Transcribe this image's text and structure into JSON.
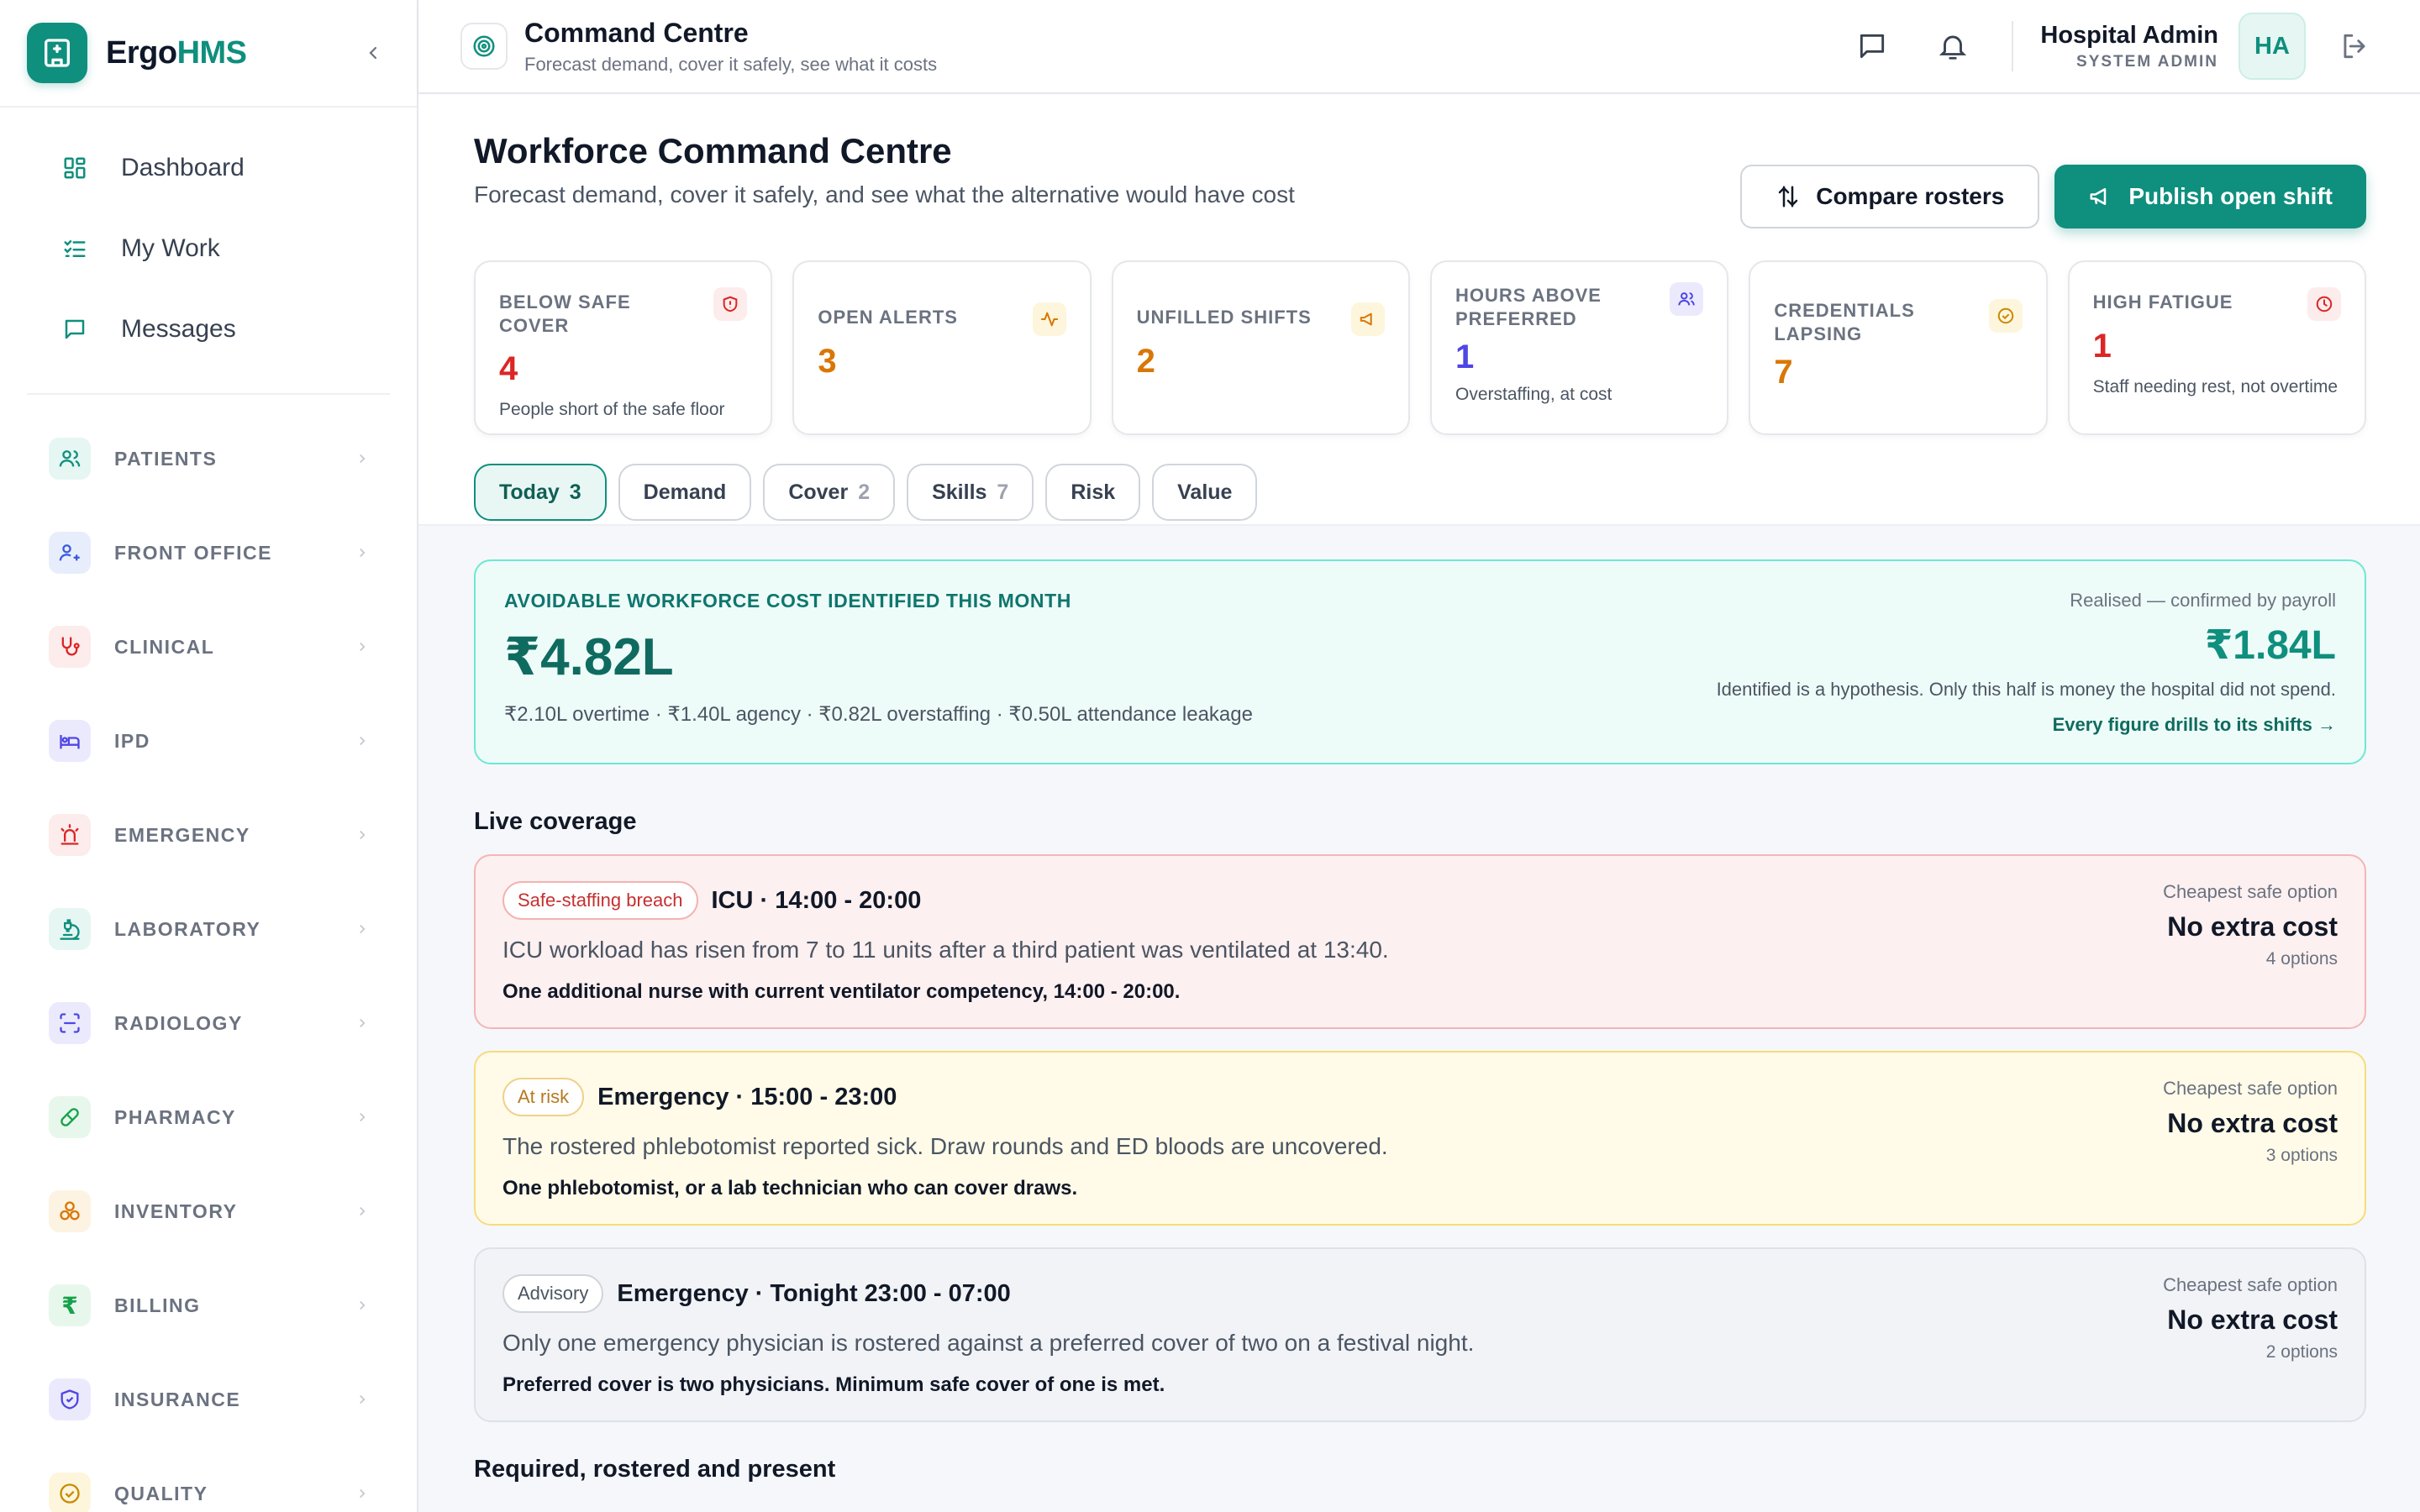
{
  "brand": {
    "name_prefix": "Ergo",
    "name_suffix": "HMS"
  },
  "primary_nav": [
    {
      "label": "Dashboard",
      "icon": "dashboard-icon"
    },
    {
      "label": "My Work",
      "icon": "checklist-icon"
    },
    {
      "label": "Messages",
      "icon": "message-icon"
    }
  ],
  "modules": [
    {
      "label": "PATIENTS",
      "icon": "users-icon",
      "color": "#0f8f7e",
      "bg": "#e6f6f3"
    },
    {
      "label": "FRONT OFFICE",
      "icon": "user-plus-icon",
      "color": "#3b5bdb",
      "bg": "#e8edfc"
    },
    {
      "label": "CLINICAL",
      "icon": "stethoscope-icon",
      "color": "#dc2626",
      "bg": "#fdecec"
    },
    {
      "label": "IPD",
      "icon": "bed-icon",
      "color": "#4f46e5",
      "bg": "#ebeafd"
    },
    {
      "label": "EMERGENCY",
      "icon": "siren-icon",
      "color": "#dc2626",
      "bg": "#fdecec"
    },
    {
      "label": "LABORATORY",
      "icon": "microscope-icon",
      "color": "#0f8f7e",
      "bg": "#e6f6f3"
    },
    {
      "label": "RADIOLOGY",
      "icon": "scan-icon",
      "color": "#4f46e5",
      "bg": "#ebeafd"
    },
    {
      "label": "PHARMACY",
      "icon": "pill-icon",
      "color": "#16a34a",
      "bg": "#e8f7ec"
    },
    {
      "label": "INVENTORY",
      "icon": "boxes-icon",
      "color": "#d97706",
      "bg": "#fdf3e3"
    },
    {
      "label": "BILLING",
      "icon": "rupee-icon",
      "color": "#16a34a",
      "bg": "#e8f7ec",
      "glyph": "₹"
    },
    {
      "label": "INSURANCE",
      "icon": "shield-icon",
      "color": "#4f46e5",
      "bg": "#ebeafd"
    },
    {
      "label": "QUALITY",
      "icon": "badge-check-icon",
      "color": "#ca8a04",
      "bg": "#fdf6dc"
    }
  ],
  "topbar": {
    "title": "Command Centre",
    "subtitle": "Forecast demand, cover it safely, see what it costs",
    "user_name": "Hospital Admin",
    "user_role": "SYSTEM ADMIN",
    "avatar": "HA"
  },
  "page": {
    "title": "Workforce Command Centre",
    "subtitle": "Forecast demand, cover it safely, and see what the alternative would have cost",
    "compare_label": "Compare rosters",
    "publish_label": "Publish open shift"
  },
  "kpis": [
    {
      "label": "BELOW SAFE COVER",
      "value": "4",
      "desc": "People short of the safe floor",
      "color": "#dc2626",
      "icon": "shield-alert-icon",
      "icon_bg": "#fdecec"
    },
    {
      "label": "OPEN ALERTS",
      "value": "3",
      "desc": "",
      "color": "#d97706",
      "icon": "activity-icon",
      "icon_bg": "#fdf6dc"
    },
    {
      "label": "UNFILLED SHIFTS",
      "value": "2",
      "desc": "",
      "color": "#d97706",
      "icon": "megaphone-icon",
      "icon_bg": "#fdf6dc"
    },
    {
      "label": "HOURS ABOVE PREFERRED",
      "value": "1",
      "desc": "Overstaffing, at cost",
      "color": "#4f46e5",
      "icon": "users-icon",
      "icon_bg": "#ebeafd"
    },
    {
      "label": "CREDENTIALS LAPSING",
      "value": "7",
      "desc": "",
      "color": "#d97706",
      "icon": "badge-check-icon",
      "icon_bg": "#fdf6dc"
    },
    {
      "label": "HIGH FATIGUE",
      "value": "1",
      "desc": "Staff needing rest, not overtime",
      "color": "#dc2626",
      "icon": "clock-icon",
      "icon_bg": "#fdecec"
    }
  ],
  "tabs": [
    {
      "label": "Today",
      "count": "3"
    },
    {
      "label": "Demand",
      "count": ""
    },
    {
      "label": "Cover",
      "count": "2"
    },
    {
      "label": "Skills",
      "count": "7"
    },
    {
      "label": "Risk",
      "count": ""
    },
    {
      "label": "Value",
      "count": ""
    }
  ],
  "savings": {
    "eyebrow": "AVOIDABLE WORKFORCE COST IDENTIFIED THIS MONTH",
    "value": "₹4.82L",
    "breakdown": "₹2.10L overtime · ₹1.40L agency · ₹0.82L overstaffing · ₹0.50L attendance leakage",
    "realised_label": "Realised — confirmed by payroll",
    "realised_value": "₹1.84L",
    "note": "Identified is a hypothesis. Only this half is money the hospital did not spend.",
    "link": "Every figure drills to its shifts →"
  },
  "live_coverage": {
    "title": "Live coverage",
    "cards": [
      {
        "severity": "breach",
        "badge": "Safe-staffing breach",
        "title": "ICU · 14:00 - 20:00",
        "desc": "ICU workload has risen from 7 to 11 units after a third patient was ventilated at 13:40.",
        "action": "One additional nurse with current ventilator competency, 14:00 - 20:00.",
        "opt_label": "Cheapest safe option",
        "opt_value": "No extra cost",
        "opt_count": "4 options"
      },
      {
        "severity": "risk",
        "badge": "At risk",
        "title": "Emergency · 15:00 - 23:00",
        "desc": "The rostered phlebotomist reported sick. Draw rounds and ED bloods are uncovered.",
        "action": "One phlebotomist, or a lab technician who can cover draws.",
        "opt_label": "Cheapest safe option",
        "opt_value": "No extra cost",
        "opt_count": "3 options"
      },
      {
        "severity": "advisory",
        "badge": "Advisory",
        "title": "Emergency · Tonight 23:00 - 07:00",
        "desc": "Only one emergency physician is rostered against a preferred cover of two on a festival night.",
        "action": "Preferred cover is two physicians. Minimum safe cover of one is met.",
        "opt_label": "Cheapest safe option",
        "opt_value": "No extra cost",
        "opt_count": "2 options"
      }
    ]
  },
  "section2_title": "Required, rostered and present"
}
